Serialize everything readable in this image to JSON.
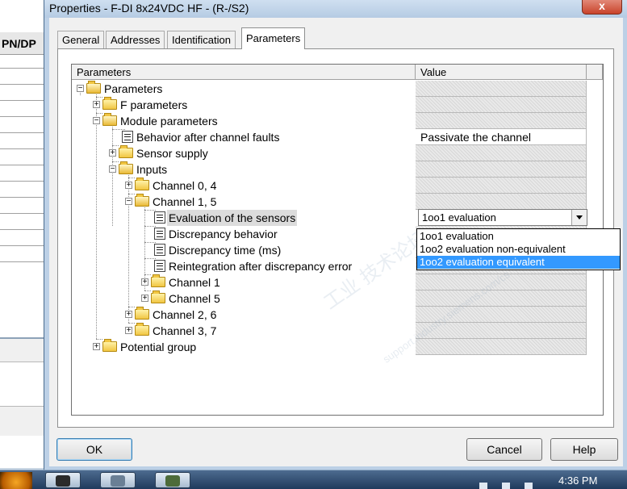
{
  "window": {
    "title": "Properties - F-DI 8x24VDC HF - (R-/S2)",
    "close_glyph": "x"
  },
  "background_app": {
    "column_header": "PN/DP"
  },
  "tabs": [
    {
      "label": "General"
    },
    {
      "label": "Addresses"
    },
    {
      "label": "Identification"
    },
    {
      "label": "Parameters",
      "active": true
    }
  ],
  "grid": {
    "col_parameters": "Parameters",
    "col_value": "Value",
    "rows": [
      {
        "label": "Parameters"
      },
      {
        "label": "F parameters"
      },
      {
        "label": "Module parameters"
      },
      {
        "label": "Behavior after channel faults",
        "value": "Passivate the channel"
      },
      {
        "label": "Sensor supply"
      },
      {
        "label": "Inputs"
      },
      {
        "label": "Channel 0, 4"
      },
      {
        "label": "Channel 1, 5"
      },
      {
        "label": "Evaluation of the sensors",
        "value": "1oo1 evaluation"
      },
      {
        "label": "Discrepancy behavior"
      },
      {
        "label": "Discrepancy time (ms)"
      },
      {
        "label": "Reintegration after discrepancy error"
      },
      {
        "label": "Channel 1"
      },
      {
        "label": "Channel 5"
      },
      {
        "label": "Channel 2, 6"
      },
      {
        "label": "Channel 3, 7"
      },
      {
        "label": "Potential group"
      }
    ]
  },
  "dropdown": {
    "options": [
      "1oo1 evaluation",
      "1oo2 evaluation non-equivalent",
      "1oo2 evaluation equivalent"
    ],
    "highlighted_index": 2
  },
  "watermark": {
    "text": "工业 技术论坛",
    "url": "support.industry.siemens.com/cs"
  },
  "buttons": {
    "ok": "OK",
    "cancel": "Cancel",
    "help": "Help"
  },
  "taskbar": {
    "clock": "4:36 PM"
  },
  "colors": {
    "selection": "#3399ff",
    "title_bg": "#bcd0e6",
    "close_red": "#c9432b"
  }
}
